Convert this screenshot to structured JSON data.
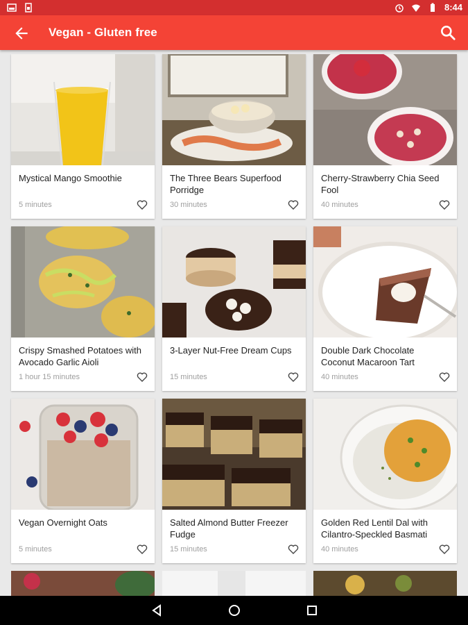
{
  "status_bar": {
    "time": "8:44",
    "left_icons": [
      "image-icon",
      "sim-icon"
    ],
    "right_icons": [
      "alarm-icon",
      "wifi-icon",
      "battery-icon"
    ]
  },
  "app_bar": {
    "title": "Vegan - Gluten free",
    "back_icon": "arrow-back-icon",
    "search_icon": "search-icon",
    "color": "#f44336",
    "status_color": "#d32f2f"
  },
  "recipes": [
    {
      "title": "Mystical Mango Smoothie",
      "time": "5 minutes"
    },
    {
      "title": "The Three Bears Superfood Porridge",
      "time": "30 minutes"
    },
    {
      "title": "Cherry-Strawberry Chia Seed Fool",
      "time": "40 minutes"
    },
    {
      "title": "Crispy Smashed Potatoes with Avocado Garlic Aioli",
      "time": "1 hour 15 minutes"
    },
    {
      "title": "3-Layer Nut-Free Dream Cups",
      "time": "15 minutes"
    },
    {
      "title": "Double Dark Chocolate Coconut Macaroon Tart",
      "time": "40 minutes"
    },
    {
      "title": "Vegan Overnight Oats",
      "time": "5 minutes"
    },
    {
      "title": "Salted Almond Butter Freezer Fudge",
      "time": "15 minutes"
    },
    {
      "title": "Golden Red Lentil Dal with Cilantro-Speckled Basmati",
      "time": "40 minutes"
    }
  ],
  "nav_bar": {
    "icons": [
      "back-triangle-icon",
      "home-circle-icon",
      "recents-square-icon"
    ]
  }
}
